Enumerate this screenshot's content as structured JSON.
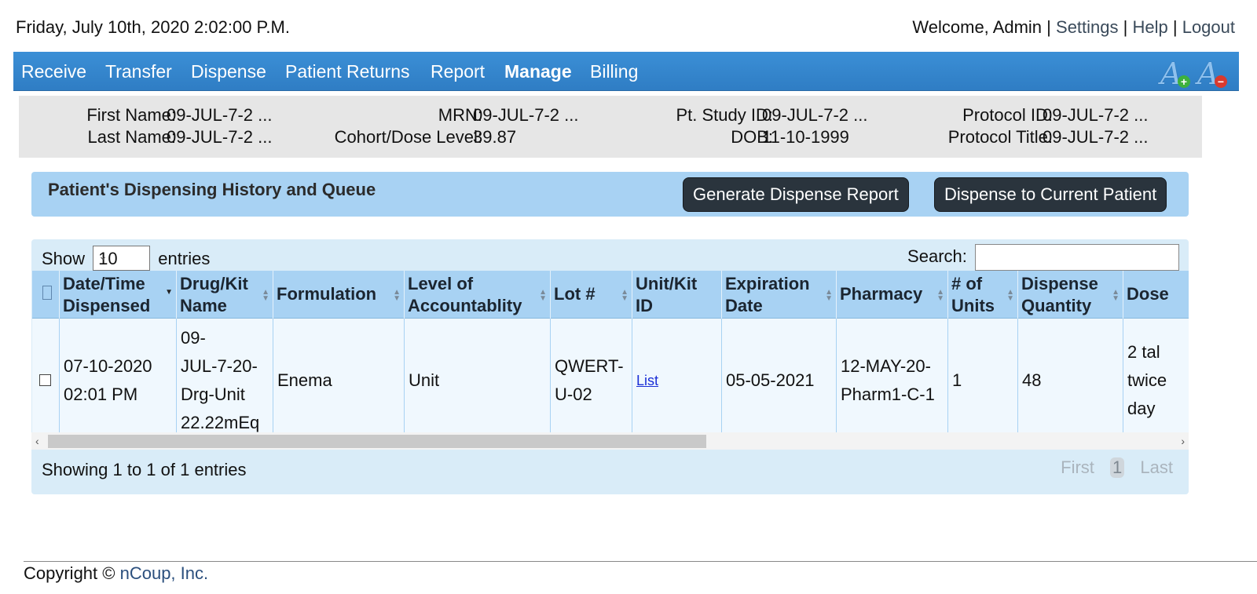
{
  "header": {
    "datetime": "Friday, July 10th, 2020 2:02:00 P.M.",
    "welcome": "Welcome, Admin",
    "settings": "Settings",
    "help": "Help",
    "logout": "Logout",
    "separator": "|"
  },
  "nav": {
    "items": [
      "Receive",
      "Transfer",
      "Dispense",
      "Patient Returns",
      "Report",
      "Manage",
      "Billing"
    ],
    "active": "Manage",
    "font_increase_icon": "font-increase-icon",
    "font_decrease_icon": "font-decrease-icon",
    "font_glyph": "A",
    "plus": "+",
    "minus": "−"
  },
  "patient": {
    "first_name_label": "First Name:",
    "first_name": "09-JUL-7-2 ...",
    "last_name_label": "Last Name:",
    "last_name": "09-JUL-7-2 ...",
    "mrn_label": "MRN:",
    "mrn": "09-JUL-7-2 ...",
    "cohort_label": "Cohort/Dose Level:",
    "cohort": "39.87",
    "study_id_label": "Pt. Study ID:",
    "study_id": "09-JUL-7-2 ...",
    "dob_label": "DOB:",
    "dob": "11-10-1999",
    "protocol_id_label": "Protocol ID:",
    "protocol_id": "09-JUL-7-2 ...",
    "protocol_title_label": "Protocol Title:",
    "protocol_title": "09-JUL-7-2 ..."
  },
  "history": {
    "title": "Patient's Dispensing History and Queue",
    "generate_button": "Generate Dispense Report",
    "dispense_button": "Dispense to Current Patient"
  },
  "table": {
    "show_label": "Show",
    "entries_label": "entries",
    "page_size": "10",
    "search_label": "Search:",
    "search_value": "",
    "columns": [
      "Date/Time\nDispensed",
      "Drug/Kit\nName",
      "Formulation",
      "Level of\nAccountablity",
      "Lot #",
      "Unit/Kit\nID",
      "Expiration\nDate",
      "Pharmacy",
      "# of\nUnits",
      "Dispense\nQuantity",
      "Dose"
    ],
    "rows": [
      {
        "date": "07-10-2020\n02:01 PM",
        "drug": "09-\nJUL-7-20-\nDrg-Unit\n22.22mEq",
        "formulation": "Enema",
        "level": "Unit",
        "lot": "QWERT-\nU-02",
        "unit_kit": "List",
        "expiration": "05-05-2021",
        "pharmacy": "12-MAY-20-\nPharm1-C-1",
        "units": "1",
        "quantity": "48",
        "dose": "2 tal\ntwice\nday"
      }
    ],
    "info": "Showing 1 to 1 of 1 entries",
    "pager": {
      "first": "First",
      "page": "1",
      "last": "Last"
    },
    "scroll_left": "‹",
    "scroll_right": "›"
  },
  "footer": {
    "copyright": "Copyright © ",
    "company": "nCoup, Inc."
  }
}
